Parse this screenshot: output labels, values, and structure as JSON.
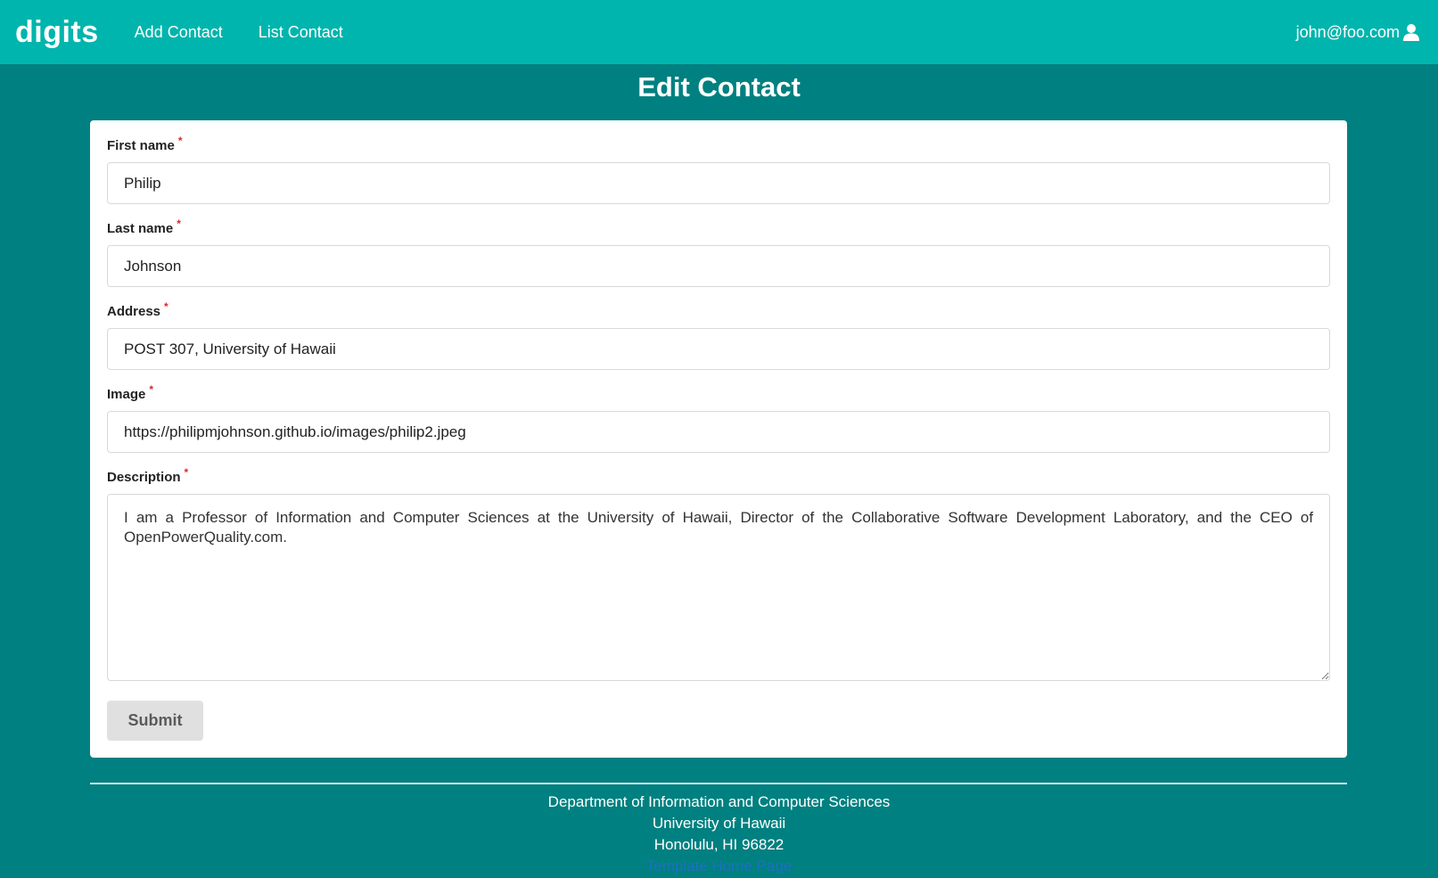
{
  "navbar": {
    "brand": "digits",
    "links": [
      "Add Contact",
      "List Contact"
    ],
    "user_email": "john@foo.com",
    "user_icon": "user-icon"
  },
  "page": {
    "title": "Edit Contact"
  },
  "form": {
    "required_marker": "*",
    "fields": {
      "first_name": {
        "label": "First name",
        "value": "Philip"
      },
      "last_name": {
        "label": "Last name",
        "value": "Johnson"
      },
      "address": {
        "label": "Address",
        "value": "POST 307, University of Hawaii"
      },
      "image": {
        "label": "Image",
        "value": "https://philipmjohnson.github.io/images/philip2.jpeg"
      },
      "description": {
        "label": "Description",
        "value": "I am a Professor of Information and Computer Sciences at the University of Hawaii, Director of the Collaborative Software Development Laboratory, and the CEO of OpenPowerQuality.com."
      }
    },
    "submit_label": "Submit"
  },
  "footer": {
    "lines": [
      "Department of Information and Computer Sciences",
      "University of Hawaii",
      "Honolulu, HI 96822"
    ],
    "link_text": "Template Home Page"
  },
  "colors": {
    "navbar_bg": "#00b5ad",
    "page_bg": "#008080",
    "required": "#db2828",
    "link": "#1e70bf"
  }
}
